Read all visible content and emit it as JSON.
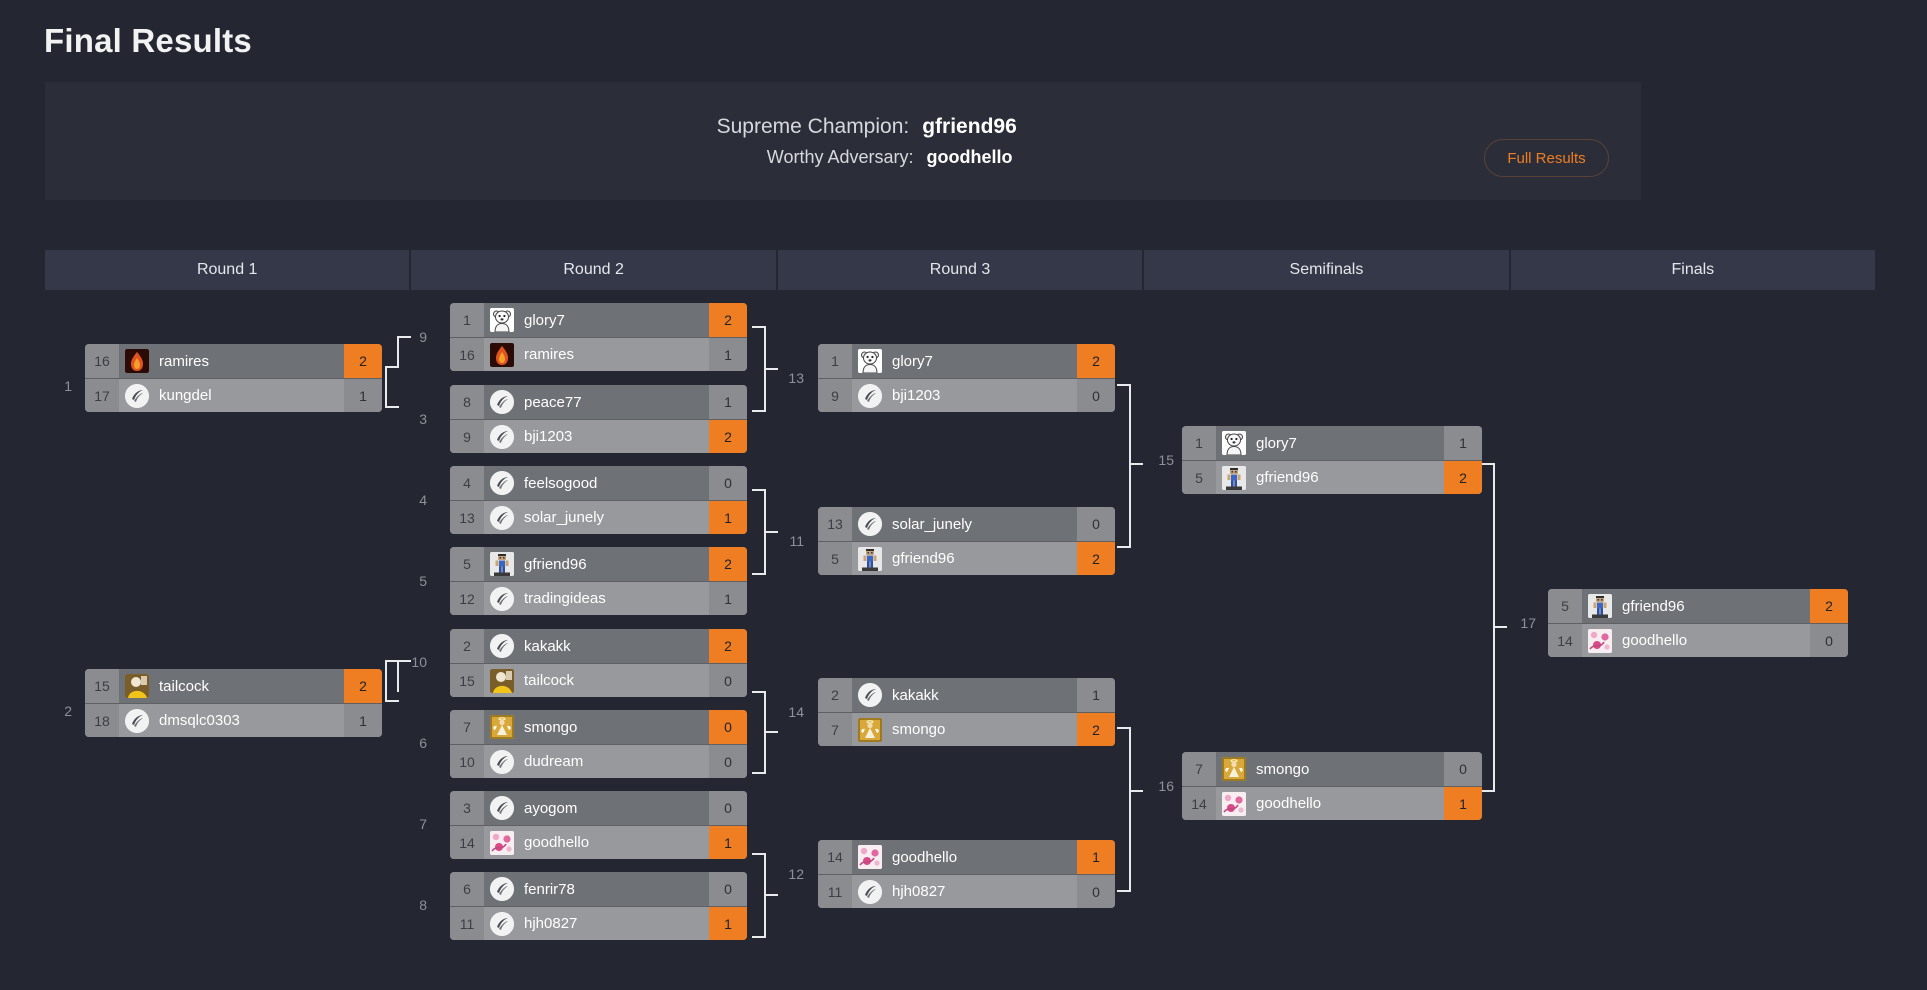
{
  "page": {
    "title": "Final Results",
    "background_color": "#242731",
    "accent_color": "#ef7d22"
  },
  "champion_banner": {
    "champion_label": "Supreme Champion:",
    "champion_name": "gfriend96",
    "runner_up_label": "Worthy Adversary:",
    "runner_up_name": "goodhello",
    "full_results_button": "Full Results"
  },
  "rounds": [
    {
      "label": "Round 1"
    },
    {
      "label": "Round 2"
    },
    {
      "label": "Round 3"
    },
    {
      "label": "Semifinals"
    },
    {
      "label": "Finals"
    }
  ],
  "matches": {
    "m1": {
      "number": "1",
      "top": {
        "seed": "16",
        "name": "ramires",
        "score": "2",
        "winner": true,
        "avatar": "flame-avatar"
      },
      "bottom": {
        "seed": "17",
        "name": "kungdel",
        "score": "1",
        "winner": false,
        "avatar": "default-logo-avatar"
      }
    },
    "m2": {
      "number": "2",
      "top": {
        "seed": "15",
        "name": "tailcock",
        "score": "2",
        "winner": true,
        "avatar": "yellow-photo-avatar"
      },
      "bottom": {
        "seed": "18",
        "name": "dmsqlc0303",
        "score": "1",
        "winner": false,
        "avatar": "default-logo-avatar"
      }
    },
    "m3": {
      "number": "9",
      "top": {
        "seed": "1",
        "name": "glory7",
        "score": "2",
        "winner": true,
        "avatar": "polar-bear-avatar"
      },
      "bottom": {
        "seed": "16",
        "name": "ramires",
        "score": "1",
        "winner": false,
        "avatar": "flame-avatar"
      }
    },
    "m4": {
      "number": "3",
      "top": {
        "seed": "8",
        "name": "peace77",
        "score": "1",
        "winner": false,
        "avatar": "default-logo-avatar"
      },
      "bottom": {
        "seed": "9",
        "name": "bji1203",
        "score": "2",
        "winner": true,
        "avatar": "default-logo-avatar"
      }
    },
    "m5": {
      "number": "4",
      "top": {
        "seed": "4",
        "name": "feelsogood",
        "score": "0",
        "winner": false,
        "avatar": "default-logo-avatar"
      },
      "bottom": {
        "seed": "13",
        "name": "solar_junely",
        "score": "1",
        "winner": true,
        "avatar": "default-logo-avatar"
      }
    },
    "m6": {
      "number": "5",
      "top": {
        "seed": "5",
        "name": "gfriend96",
        "score": "2",
        "winner": true,
        "avatar": "minecraft-avatar"
      },
      "bottom": {
        "seed": "12",
        "name": "tradingideas",
        "score": "1",
        "winner": false,
        "avatar": "default-logo-avatar"
      }
    },
    "m7": {
      "number": "10",
      "top": {
        "seed": "2",
        "name": "kakakk",
        "score": "2",
        "winner": true,
        "avatar": "default-logo-avatar"
      },
      "bottom": {
        "seed": "15",
        "name": "tailcock",
        "score": "0",
        "winner": false,
        "avatar": "yellow-photo-avatar"
      }
    },
    "m8": {
      "number": "6",
      "top": {
        "seed": "7",
        "name": "smongo",
        "score": "0",
        "winner": true,
        "avatar": "angel-avatar"
      },
      "bottom": {
        "seed": "10",
        "name": "dudream",
        "score": "0",
        "winner": false,
        "avatar": "default-logo-avatar"
      }
    },
    "m9": {
      "number": "7",
      "top": {
        "seed": "3",
        "name": "ayogom",
        "score": "0",
        "winner": false,
        "avatar": "default-logo-avatar"
      },
      "bottom": {
        "seed": "14",
        "name": "goodhello",
        "score": "1",
        "winner": true,
        "avatar": "pink-pattern-avatar"
      }
    },
    "m10": {
      "number": "8",
      "top": {
        "seed": "6",
        "name": "fenrir78",
        "score": "0",
        "winner": false,
        "avatar": "default-logo-avatar"
      },
      "bottom": {
        "seed": "11",
        "name": "hjh0827",
        "score": "1",
        "winner": true,
        "avatar": "default-logo-avatar"
      }
    },
    "m11": {
      "number": "13",
      "top": {
        "seed": "1",
        "name": "glory7",
        "score": "2",
        "winner": true,
        "avatar": "polar-bear-avatar"
      },
      "bottom": {
        "seed": "9",
        "name": "bji1203",
        "score": "0",
        "winner": false,
        "avatar": "default-logo-avatar"
      }
    },
    "m12": {
      "number": "11",
      "top": {
        "seed": "13",
        "name": "solar_junely",
        "score": "0",
        "winner": false,
        "avatar": "default-logo-avatar"
      },
      "bottom": {
        "seed": "5",
        "name": "gfriend96",
        "score": "2",
        "winner": true,
        "avatar": "minecraft-avatar"
      }
    },
    "m13": {
      "number": "14",
      "top": {
        "seed": "2",
        "name": "kakakk",
        "score": "1",
        "winner": false,
        "avatar": "default-logo-avatar"
      },
      "bottom": {
        "seed": "7",
        "name": "smongo",
        "score": "2",
        "winner": true,
        "avatar": "angel-avatar"
      }
    },
    "m14": {
      "number": "12",
      "top": {
        "seed": "14",
        "name": "goodhello",
        "score": "1",
        "winner": true,
        "avatar": "pink-pattern-avatar"
      },
      "bottom": {
        "seed": "11",
        "name": "hjh0827",
        "score": "0",
        "winner": false,
        "avatar": "default-logo-avatar"
      }
    },
    "m15": {
      "number": "15",
      "top": {
        "seed": "1",
        "name": "glory7",
        "score": "1",
        "winner": false,
        "avatar": "polar-bear-avatar"
      },
      "bottom": {
        "seed": "5",
        "name": "gfriend96",
        "score": "2",
        "winner": true,
        "avatar": "minecraft-avatar"
      }
    },
    "m16": {
      "number": "16",
      "top": {
        "seed": "7",
        "name": "smongo",
        "score": "0",
        "winner": false,
        "avatar": "angel-avatar"
      },
      "bottom": {
        "seed": "14",
        "name": "goodhello",
        "score": "1",
        "winner": true,
        "avatar": "pink-pattern-avatar"
      }
    },
    "m17": {
      "number": "17",
      "top": {
        "seed": "5",
        "name": "gfriend96",
        "score": "2",
        "winner": true,
        "avatar": "minecraft-avatar"
      },
      "bottom": {
        "seed": "14",
        "name": "goodhello",
        "score": "0",
        "winner": false,
        "avatar": "pink-pattern-avatar"
      }
    }
  }
}
